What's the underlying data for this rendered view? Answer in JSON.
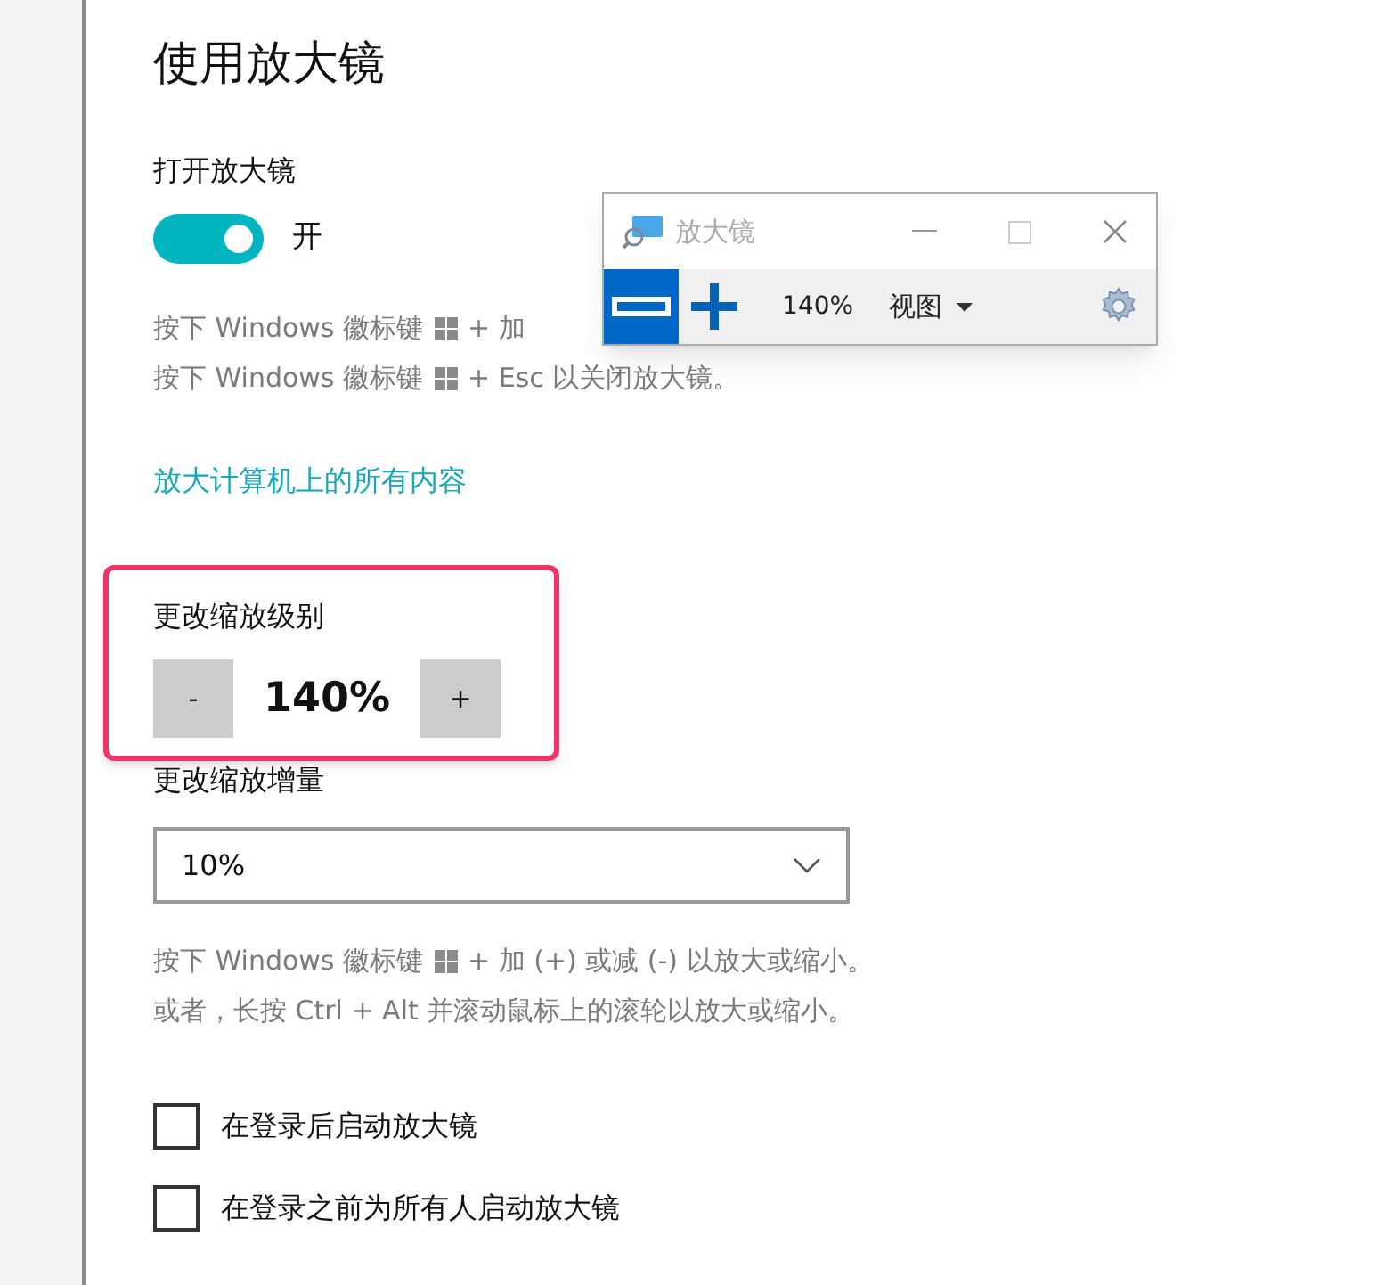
{
  "title": "使用放大镜",
  "magnifier_toggle": {
    "label": "打开放大镜",
    "on": true,
    "state_text": "开"
  },
  "shortcut_hints": [
    {
      "before_key": "按下 Windows 徽标键",
      "after_key": "+ 加"
    },
    {
      "before_key": "按下 Windows 徽标键",
      "after_key": "+ Esc 以关闭放大镜。"
    }
  ],
  "link": "放大计算机上的所有内容",
  "zoom_level": {
    "label": "更改缩放级别",
    "decrease": "-",
    "value": "140%",
    "increase": "+"
  },
  "zoom_increment": {
    "label": "更改缩放增量",
    "value": "10%"
  },
  "zoom_hints": [
    {
      "before_key": "按下 Windows 徽标键",
      "after_key": "+ 加 (+) 或减 (-) 以放大或缩小。"
    },
    {
      "text": "或者，长按 Ctrl + Alt 并滚动鼠标上的滚轮以放大或缩小。"
    }
  ],
  "checkboxes": [
    {
      "label": "在登录后启动放大镜",
      "checked": false
    },
    {
      "label": "在登录之前为所有人启动放大镜",
      "checked": false
    }
  ],
  "magnifier_window": {
    "title": "放大镜",
    "zoom": "140%",
    "view_menu": "视图"
  }
}
